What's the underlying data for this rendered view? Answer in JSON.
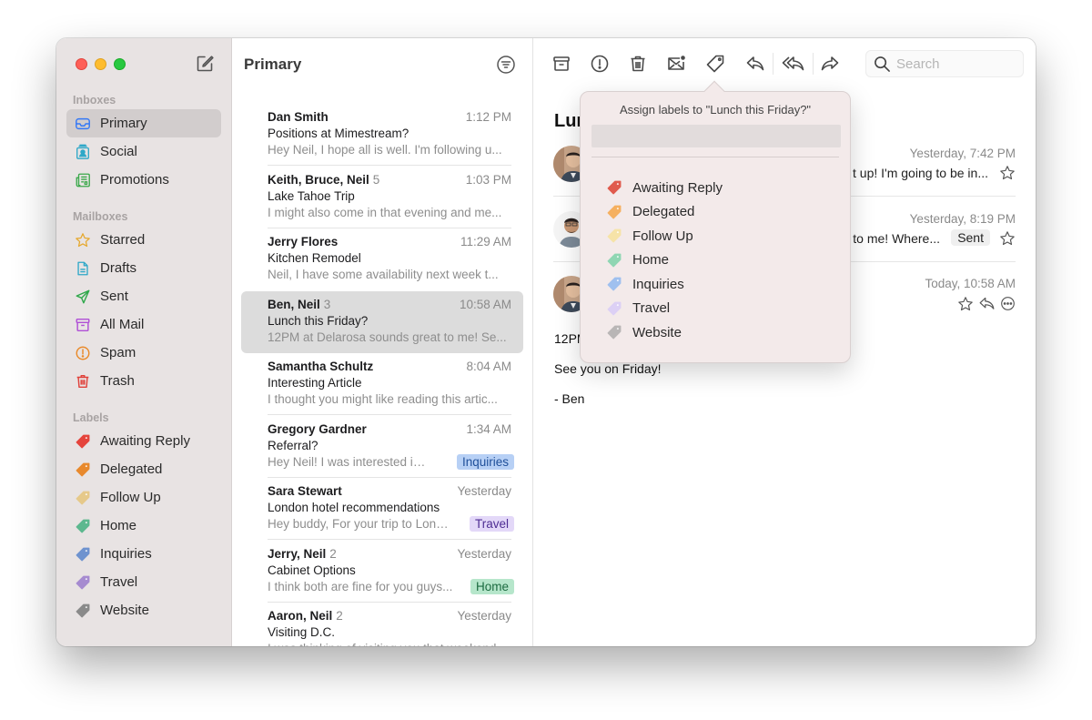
{
  "window": {
    "traffic_lights": [
      "close",
      "minimize",
      "zoom"
    ]
  },
  "sidebar": {
    "compose_icon": "compose-icon",
    "sections": {
      "inboxes": "Inboxes",
      "mailboxes": "Mailboxes",
      "labels": "Labels"
    },
    "inboxes": [
      {
        "label": "Primary",
        "icon": "inbox-tray-icon",
        "color": "#3478f6",
        "selected": true
      },
      {
        "label": "Social",
        "icon": "people-icon",
        "color": "#2fa8c8",
        "selected": false
      },
      {
        "label": "Promotions",
        "icon": "newspaper-icon",
        "color": "#3aa84a",
        "selected": false
      }
    ],
    "mailboxes": [
      {
        "label": "Starred",
        "icon": "star-icon",
        "color": "#e6a930"
      },
      {
        "label": "Drafts",
        "icon": "document-icon",
        "color": "#2fa8c8"
      },
      {
        "label": "Sent",
        "icon": "paper-plane-icon",
        "color": "#2fa84a"
      },
      {
        "label": "All Mail",
        "icon": "archive-box-icon",
        "color": "#b04fd6"
      },
      {
        "label": "Spam",
        "icon": "exclamation-circle-icon",
        "color": "#e98a2a"
      },
      {
        "label": "Trash",
        "icon": "trash-icon",
        "color": "#e0413a"
      }
    ],
    "labels": [
      {
        "label": "Awaiting Reply",
        "color": "#e5443c"
      },
      {
        "label": "Delegated",
        "color": "#e8892d"
      },
      {
        "label": "Follow Up",
        "color": "#e6c98a"
      },
      {
        "label": "Home",
        "color": "#5db88f"
      },
      {
        "label": "Inquiries",
        "color": "#6f93cf"
      },
      {
        "label": "Travel",
        "color": "#a68bd0"
      },
      {
        "label": "Website",
        "color": "#8a8a8a"
      }
    ]
  },
  "message_list": {
    "title": "Primary",
    "filter_icon": "filter-icon",
    "messages": [
      {
        "sender": "Dan Smith",
        "count": "",
        "time": "1:12 PM",
        "subject": "Positions at Mimestream?",
        "preview": "Hey Neil, I hope all is well. I'm following u...",
        "tag": null
      },
      {
        "sender": "Keith, Bruce, Neil",
        "count": "5",
        "time": "1:03 PM",
        "subject": "Lake Tahoe Trip",
        "preview": "I might also come in that evening and me...",
        "tag": null
      },
      {
        "sender": "Jerry Flores",
        "count": "",
        "time": "11:29 AM",
        "subject": "Kitchen Remodel",
        "preview": "Neil, I have some availability next week t...",
        "tag": null
      },
      {
        "sender": "Ben, Neil",
        "count": "3",
        "time": "10:58 AM",
        "subject": "Lunch this Friday?",
        "preview": "12PM at Delarosa sounds great to me! Se...",
        "tag": null,
        "selected": true
      },
      {
        "sender": "Samantha Schultz",
        "count": "",
        "time": "8:04 AM",
        "subject": "Interesting Article",
        "preview": "I thought you might like reading this artic...",
        "tag": null
      },
      {
        "sender": "Gregory Gardner",
        "count": "",
        "time": "1:34 AM",
        "subject": "Referral?",
        "preview": "Hey Neil! I was interested in a...",
        "tag": {
          "label": "Inquiries",
          "bg": "#b7d0f5",
          "fg": "#1f4f9a"
        }
      },
      {
        "sender": "Sara Stewart",
        "count": "",
        "time": "Yesterday",
        "subject": "London hotel recommendations",
        "preview": "Hey buddy, For your trip to Lond...",
        "tag": {
          "label": "Travel",
          "bg": "#e3d8f8",
          "fg": "#4e2d93"
        }
      },
      {
        "sender": "Jerry, Neil",
        "count": "2",
        "time": "Yesterday",
        "subject": "Cabinet Options",
        "preview": "I think both are fine for you guys...",
        "tag": {
          "label": "Home",
          "bg": "#b6e6cb",
          "fg": "#1c6b40"
        }
      },
      {
        "sender": "Aaron, Neil",
        "count": "2",
        "time": "Yesterday",
        "subject": "Visiting D.C.",
        "preview": "I was thinking of visiting you that weekend...",
        "tag": null
      }
    ]
  },
  "toolbar": {
    "buttons": [
      {
        "name": "archive-button",
        "icon": "archive-box-icon"
      },
      {
        "name": "spam-button",
        "icon": "exclamation-circle-icon"
      },
      {
        "name": "trash-button",
        "icon": "trash-icon"
      },
      {
        "name": "mark-unread-button",
        "icon": "envelope-dot-icon"
      },
      {
        "name": "labels-button",
        "icon": "tag-icon"
      },
      {
        "name": "reply-button",
        "icon": "reply-icon"
      },
      {
        "name": "reply-all-button",
        "icon": "reply-all-icon"
      },
      {
        "name": "forward-button",
        "icon": "forward-icon"
      }
    ],
    "search_placeholder": "Search"
  },
  "thread": {
    "subject": "Lunch this Friday?",
    "subject_visible": "Lun",
    "messages": [
      {
        "date": "Yesterday, 7:42 PM",
        "snippet": "t up! I'm going to be in...",
        "sent": false
      },
      {
        "date": "Yesterday, 8:19 PM",
        "snippet": "to me! Where...",
        "sent": true,
        "sent_label": "Sent"
      },
      {
        "date": "Today, 10:58 AM",
        "expanded": true
      }
    ],
    "body": {
      "line1": "12PM",
      "line2": "See you on Friday!",
      "signature": "- Ben"
    }
  },
  "label_popover": {
    "title": "Assign labels to \"Lunch this Friday?\"",
    "input_value": "",
    "labels": [
      {
        "label": "Awaiting Reply",
        "color": "#e05a4d"
      },
      {
        "label": "Delegated",
        "color": "#f5b060"
      },
      {
        "label": "Follow Up",
        "color": "#f6e3a8"
      },
      {
        "label": "Home",
        "color": "#8fd6b3"
      },
      {
        "label": "Inquiries",
        "color": "#9fc0ef"
      },
      {
        "label": "Travel",
        "color": "#dcd0f5"
      },
      {
        "label": "Website",
        "color": "#b9b6b6"
      }
    ]
  }
}
